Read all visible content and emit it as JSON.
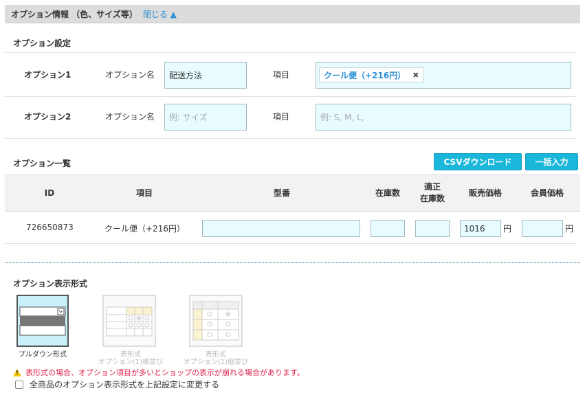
{
  "header": {
    "title": "オプション情報 （色、サイズ等）",
    "close_label": "閉じる ▲"
  },
  "settings": {
    "title": "オプション設定",
    "options": [
      {
        "label": "オプション1",
        "name_label": "オプション名",
        "name_value": "配送方法",
        "items_label": "項目",
        "tag": "クール便（+216円）",
        "tag_remove": "✖"
      },
      {
        "label": "オプション2",
        "name_label": "オプション名",
        "name_placeholder": "例: サイズ",
        "items_label": "項目",
        "items_placeholder": "例: S, M, L,"
      }
    ]
  },
  "list": {
    "title": "オプション一覧",
    "csv_button": "CSVダウンロード",
    "bulk_button": "一括入力",
    "columns": {
      "id": "ID",
      "item": "項目",
      "model": "型番",
      "stock": "在庫数",
      "proper_stock_1": "適正",
      "proper_stock_2": "在庫数",
      "price": "販売価格",
      "member_price": "会員価格"
    },
    "rows": [
      {
        "id": "726650873",
        "item": "クール便（+216円）",
        "model": "",
        "stock": "",
        "proper_stock": "",
        "price": "1016",
        "price_unit": "円",
        "member_price": "",
        "member_unit": "円"
      }
    ]
  },
  "display": {
    "title": "オプション表示形式",
    "formats": [
      {
        "caption": "プルダウン形式",
        "selected": true
      },
      {
        "caption_1": "表形式",
        "caption_2": "オプション(1)横並び",
        "selected": false
      },
      {
        "caption_1": "表形式",
        "caption_2": "オプション(1)縦並び",
        "selected": false
      }
    ],
    "warning": "表形式の場合、オプション項目が多いとショップの表示が崩れる場合があります。",
    "apply_all_label": "全商品のオプション表示形式を上記設定に変更する",
    "apply_all_checked": false
  }
}
